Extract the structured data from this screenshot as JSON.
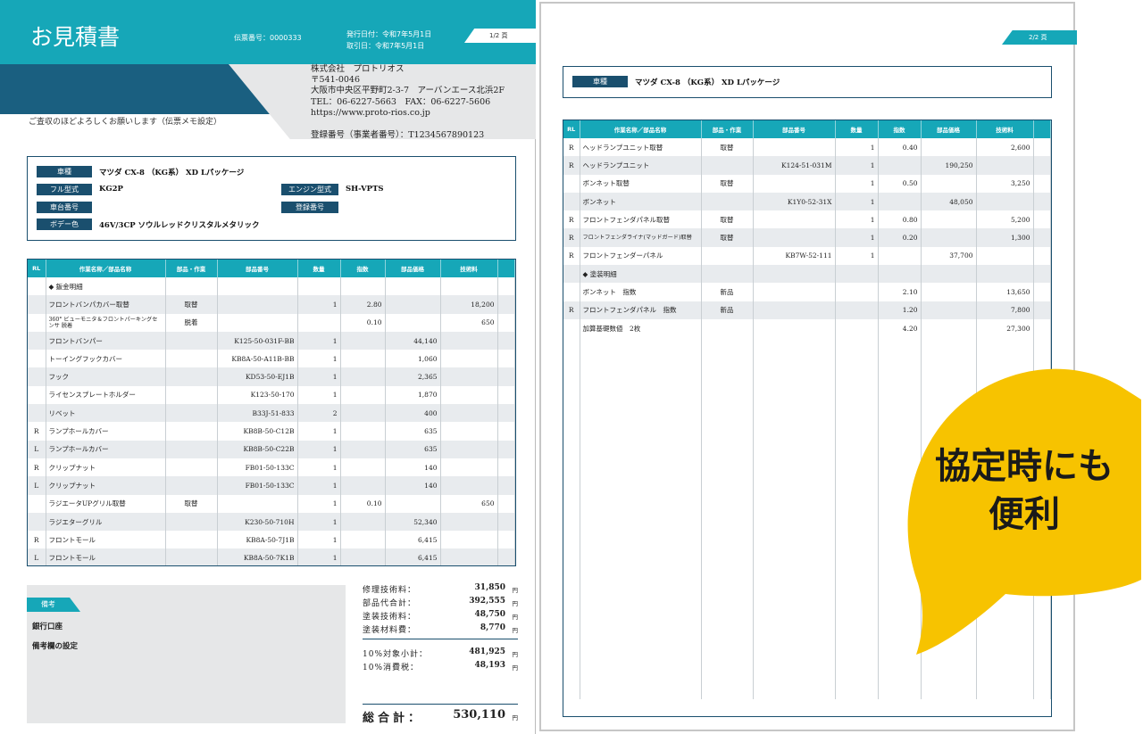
{
  "page1": {
    "title": "お見積書",
    "slip_number": "伝票番号：0000333",
    "issue_date": "発行日付：令和7年5月1日",
    "trade_date": "取引日：令和7年5月1日",
    "page_indicator": "1/2 頁",
    "company": {
      "name": "株式会社　プロトリオス",
      "postal": "〒541-0046",
      "address": "大阪市中央区平野町2-3-7　アーバンエース北浜2F",
      "phone": "TEL：06-6227-5663　FAX：06-6227-5606",
      "url": "https://www.proto-rios.co.jp",
      "registration": "登録番号（事業者番号）：T1234567890123"
    },
    "greeting": "ご査収のほどよろしくお願いします（伝票メモ設定）",
    "vehicle": {
      "car_label": "車種",
      "car_value": "マツダ CX-8 （KG系） XD Lパッケージ",
      "model_label": "フル型式",
      "model_value": "KG2P",
      "engine_label": "エンジン型式",
      "engine_value": "SH-VPTS",
      "chassis_label": "車台番号",
      "reg_label": "登録番号",
      "color_label": "ボデー色",
      "color_value": "46V/3CP ソウルレッドクリスタルメタリック"
    },
    "table": {
      "headers": [
        "RL",
        "作業名称／部品名称",
        "部品・作業",
        "部品番号",
        "数量",
        "指数",
        "部品価格",
        "技術料"
      ],
      "rows": [
        [
          "",
          "◆ 鈑金明細",
          "",
          "",
          "",
          "",
          "",
          ""
        ],
        [
          "",
          "フロントバンパカバー取替",
          "取替",
          "",
          "1",
          "2.80",
          "",
          "18,200"
        ],
        [
          "",
          "360° ビューモニタ＆フロントパーキングセンサ 脱着",
          "脱着",
          "",
          "",
          "0.10",
          "",
          "650"
        ],
        [
          "",
          "フロントバンパー",
          "",
          "K125-50-031F-BB",
          "1",
          "",
          "44,140",
          ""
        ],
        [
          "",
          "トーイングフックカバー",
          "",
          "KB8A-50-A11B-BB",
          "1",
          "",
          "1,060",
          ""
        ],
        [
          "",
          "フック",
          "",
          "KD53-50-EJ1B",
          "1",
          "",
          "2,365",
          ""
        ],
        [
          "",
          "ライセンスプレートホルダー",
          "",
          "K123-50-170",
          "1",
          "",
          "1,870",
          ""
        ],
        [
          "",
          "リベット",
          "",
          "B33J-51-833",
          "2",
          "",
          "400",
          ""
        ],
        [
          "R",
          "ランプホールカバー",
          "",
          "KB8B-50-C12B",
          "1",
          "",
          "635",
          ""
        ],
        [
          "L",
          "ランプホールカバー",
          "",
          "KB8B-50-C22B",
          "1",
          "",
          "635",
          ""
        ],
        [
          "R",
          "クリップナット",
          "",
          "FB01-50-133C",
          "1",
          "",
          "140",
          ""
        ],
        [
          "L",
          "クリップナット",
          "",
          "FB01-50-133C",
          "1",
          "",
          "140",
          ""
        ],
        [
          "",
          "ラジエータUPグリル取替",
          "取替",
          "",
          "1",
          "0.10",
          "",
          "650"
        ],
        [
          "",
          "ラジエターグリル",
          "",
          "K230-50-710H",
          "1",
          "",
          "52,340",
          ""
        ],
        [
          "R",
          "フロントモール",
          "",
          "KB8A-50-7J1B",
          "1",
          "",
          "6,415",
          ""
        ],
        [
          "L",
          "フロントモール",
          "",
          "KB8A-50-7K1B",
          "1",
          "",
          "6,415",
          ""
        ]
      ]
    },
    "remarks": {
      "label": "備考",
      "bank": "銀行口座",
      "setting": "備考欄の設定"
    },
    "totals": {
      "repair_tech_label": "修理技術料：",
      "repair_tech_value": "31,850",
      "parts_label": "部品代合計：",
      "parts_value": "392,555",
      "paint_tech_label": "塗装技術料：",
      "paint_tech_value": "48,750",
      "paint_material_label": "塗装材料費：",
      "paint_material_value": "8,770",
      "subtotal_label": "10%対象小計：",
      "subtotal_value": "481,925",
      "tax_label": "10%消費税：",
      "tax_value": "48,193",
      "grand_label": "総合計：",
      "grand_value": "530,110",
      "unit": "円"
    }
  },
  "page2": {
    "page_indicator": "2/2 頁",
    "car_label": "車種",
    "car_value": "マツダ CX-8 （KG系） XD Lパッケージ",
    "table": {
      "headers": [
        "RL",
        "作業名称／部品名称",
        "部品・作業",
        "部品番号",
        "数量",
        "指数",
        "部品価格",
        "技術料"
      ],
      "rows": [
        [
          "R",
          "ヘッドランプユニット取替",
          "取替",
          "",
          "1",
          "0.40",
          "",
          "2,600"
        ],
        [
          "R",
          "ヘッドランプユニット",
          "",
          "K124-51-031M",
          "1",
          "",
          "190,250",
          ""
        ],
        [
          "",
          "ボンネット取替",
          "取替",
          "",
          "1",
          "0.50",
          "",
          "3,250"
        ],
        [
          "",
          "ボンネット",
          "",
          "K1Y0-52-31X",
          "1",
          "",
          "48,050",
          ""
        ],
        [
          "R",
          "フロントフェンダパネル取替",
          "取替",
          "",
          "1",
          "0.80",
          "",
          "5,200"
        ],
        [
          "R",
          "フロントフェンダライナ(マッドガード)取替",
          "取替",
          "",
          "1",
          "0.20",
          "",
          "1,300"
        ],
        [
          "R",
          "フロントフェンダーパネル",
          "",
          "KB7W-52-111",
          "1",
          "",
          "37,700",
          ""
        ],
        [
          "",
          "◆ 塗装明細",
          "",
          "",
          "",
          "",
          "",
          ""
        ],
        [
          "",
          "ボンネット　指数",
          "新品",
          "",
          "",
          "2.10",
          "",
          "13,650"
        ],
        [
          "R",
          "フロントフェンダパネル　指数",
          "新品",
          "",
          "",
          "1.20",
          "",
          "7,800"
        ],
        [
          "",
          "加算基礎数値　2枚",
          "",
          "",
          "",
          "4.20",
          "",
          "27,300"
        ]
      ]
    }
  },
  "callout": {
    "line1": "協定時にも",
    "line2": "便利",
    "color": "#f7c300"
  },
  "colors": {
    "teal": "#16a7b8",
    "navy": "#1a4f6e"
  }
}
